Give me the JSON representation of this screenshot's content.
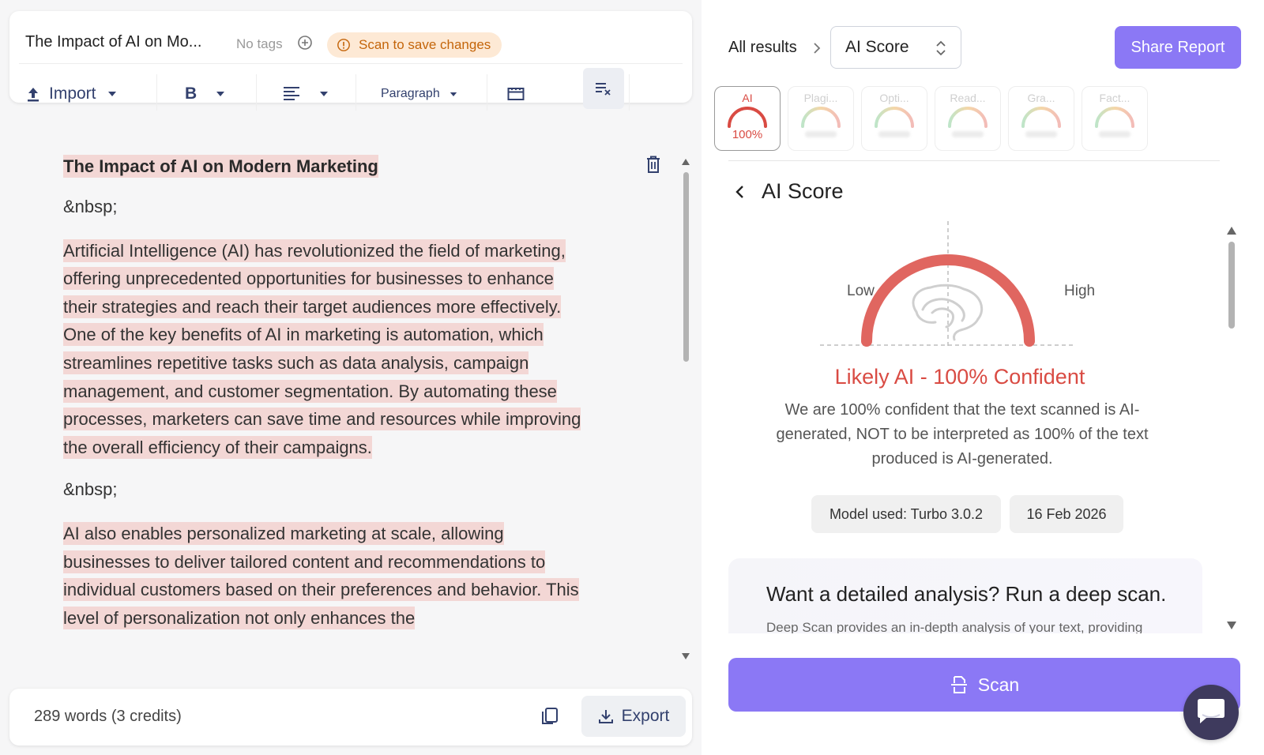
{
  "editor_header": {
    "doc_title": "The Impact of AI on Mo...",
    "tags_label": "No tags",
    "scan_notice": "Scan to save changes"
  },
  "toolbar": {
    "import_label": "Import",
    "bold_label": "B",
    "paragraph_label": "Paragraph"
  },
  "document": {
    "title": "The Impact of AI on Modern Marketing",
    "nbsp": "&nbsp;",
    "paragraphs": [
      "Artificial Intelligence (AI) has revolutionized the field of marketing, offering unprecedented opportunities for businesses to enhance their strategies and reach their target audiences more effectively. One of the key benefits of AI in marketing is automation, which streamlines repetitive tasks such as data analysis, campaign management, and customer segmentation. By automating these processes, marketers can save time and resources while improving the overall efficiency of their campaigns.",
      "AI also enables personalized marketing at scale, allowing businesses to deliver tailored content and recommendations to individual customers based on their preferences and behavior. This level of personalization not only enhances the"
    ]
  },
  "footer": {
    "word_count": "289 words (3 credits)",
    "export_label": "Export"
  },
  "results": {
    "breadcrumb_root": "All results",
    "selected_view": "AI Score",
    "share_label": "Share Report",
    "metric_tabs": [
      {
        "label": "AI",
        "value": "100%"
      },
      {
        "label": "Plagi..."
      },
      {
        "label": "Opti..."
      },
      {
        "label": "Read..."
      },
      {
        "label": "Gra..."
      },
      {
        "label": "Fact..."
      }
    ],
    "section_title": "AI Score",
    "gauge": {
      "low_label": "Low",
      "high_label": "High",
      "score_fraction": 1.0
    },
    "verdict": "Likely AI - 100% Confident",
    "verdict_desc": "We are 100% confident that the text scanned is AI-generated, NOT to be interpreted as 100% of the text produced is AI-generated.",
    "model_used": "Model used: Turbo 3.0.2",
    "scan_date": "16 Feb 2026",
    "deep_scan_title": "Want a detailed analysis? Run a deep scan.",
    "deep_scan_desc": "Deep Scan provides an in-depth analysis of your text, providing",
    "scan_button": "Scan"
  },
  "colors": {
    "accent": "#8b78f5",
    "ai_red": "#d94b43",
    "highlight": "#f3d7d5",
    "notice_bg": "#fde9d5",
    "notice_text": "#c4650a"
  },
  "icons": [
    "add-tag-icon",
    "info-icon",
    "upload-icon",
    "caret-down-icon",
    "align-left-icon",
    "calendar-icon",
    "clear-format-icon",
    "trash-icon",
    "copy-icon",
    "download-icon",
    "chevron-right-icon",
    "select-arrows-icon",
    "chevron-left-icon",
    "brain-icon",
    "scan-icon",
    "chat-icon"
  ]
}
